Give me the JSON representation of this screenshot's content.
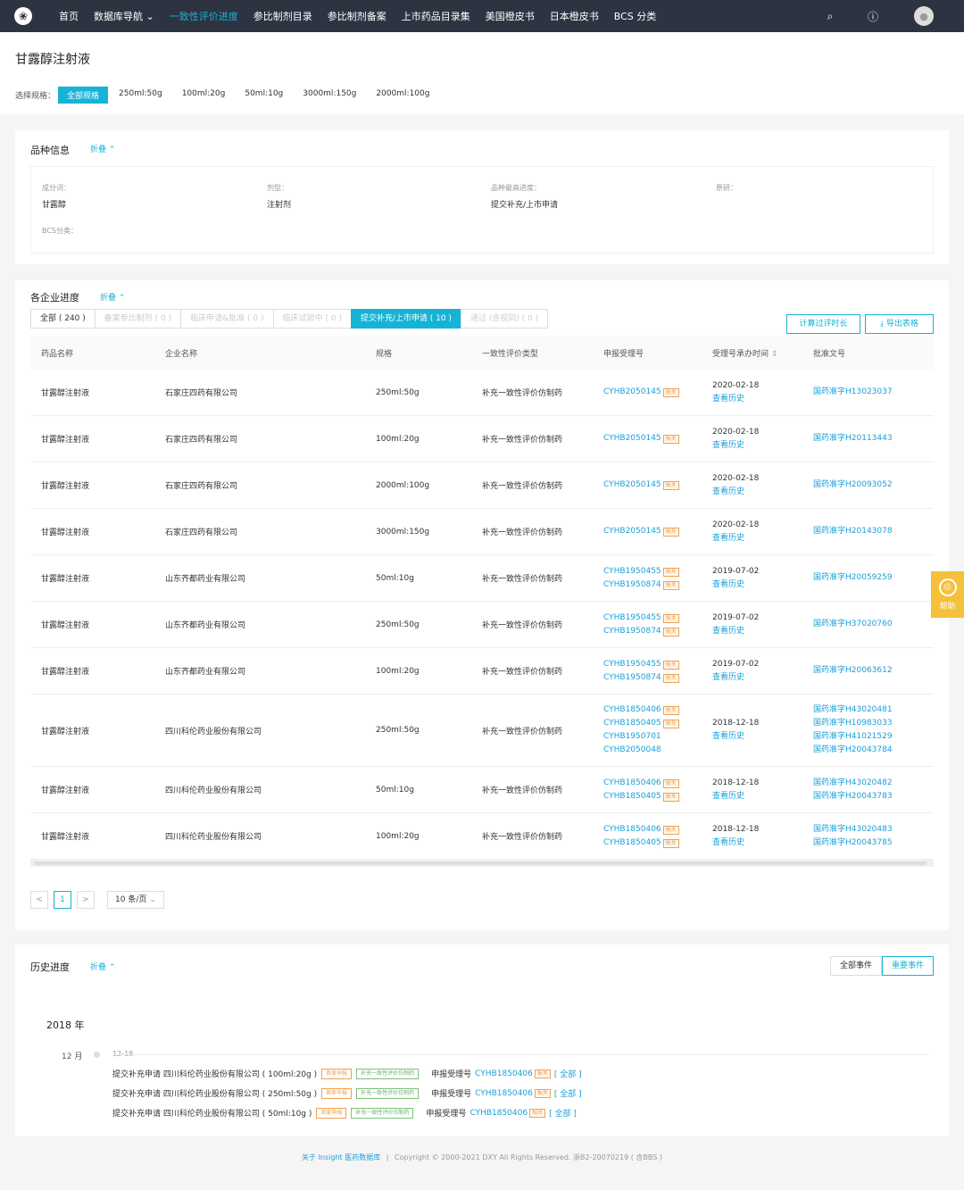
{
  "nav": {
    "items": [
      "首页",
      "数据库导航 ⌄",
      "一致性评价进度",
      "参比制剂目录",
      "参比制剂备案",
      "上市药品目录集",
      "美国橙皮书",
      "日本橙皮书",
      "BCS 分类"
    ],
    "active_index": 2
  },
  "header": {
    "title": "甘露醇注射液",
    "spec_label": "选择规格：",
    "specs": [
      "全部规格",
      "250ml:50g",
      "100ml:20g",
      "50ml:10g",
      "3000ml:150g",
      "2000ml:100g"
    ]
  },
  "variety": {
    "title": "品种信息",
    "fold": "折叠",
    "ingredient_label": "成分词：",
    "ingredient": "甘露醇",
    "form_label": "剂型：",
    "form": "注射剂",
    "progress_label": "品种最高进度：",
    "progress": "提交补充/上市申请",
    "original_label": "原研：",
    "bcs_label": "BCS分类："
  },
  "enterprise": {
    "title": "各企业进度",
    "fold": "折叠",
    "tabs": [
      "全部 ( 240 )",
      "备案参比制剂 ( 0 )",
      "临床申请&批准 ( 0 )",
      "临床试验中 ( 0 )",
      "提交补充/上市申请 ( 10 )",
      "通过 (含视同) ( 0 )"
    ],
    "calc_button": "计算过评时长",
    "export_button": "导出表格",
    "columns": [
      "药品名称",
      "企业名称",
      "规格",
      "一致性评价类型",
      "申报受理号",
      "受理号承办时间",
      "批准文号"
    ],
    "tag_text": "报关",
    "rows": [
      {
        "name": "甘露醇注射液",
        "company": "石家庄四药有限公司",
        "spec": "250ml:50g",
        "type": "补充一致性评价仿制药",
        "accept": [
          "CYHB2050145"
        ],
        "date": "2020-02-18",
        "history": "查看历史",
        "approval": [
          "国药准字H13023037"
        ]
      },
      {
        "name": "甘露醇注射液",
        "company": "石家庄四药有限公司",
        "spec": "100ml:20g",
        "type": "补充一致性评价仿制药",
        "accept": [
          "CYHB2050145"
        ],
        "date": "2020-02-18",
        "history": "查看历史",
        "approval": [
          "国药准字H20113443"
        ]
      },
      {
        "name": "甘露醇注射液",
        "company": "石家庄四药有限公司",
        "spec": "2000ml:100g",
        "type": "补充一致性评价仿制药",
        "accept": [
          "CYHB2050145"
        ],
        "date": "2020-02-18",
        "history": "查看历史",
        "approval": [
          "国药准字H20093052"
        ]
      },
      {
        "name": "甘露醇注射液",
        "company": "石家庄四药有限公司",
        "spec": "3000ml:150g",
        "type": "补充一致性评价仿制药",
        "accept": [
          "CYHB2050145"
        ],
        "date": "2020-02-18",
        "history": "查看历史",
        "approval": [
          "国药准字H20143078"
        ]
      },
      {
        "name": "甘露醇注射液",
        "company": "山东齐都药业有限公司",
        "spec": "50ml:10g",
        "type": "补充一致性评价仿制药",
        "accept": [
          "CYHB1950455",
          "CYHB1950874"
        ],
        "date": "2019-07-02",
        "history": "查看历史",
        "approval": [
          "国药准字H20059259"
        ]
      },
      {
        "name": "甘露醇注射液",
        "company": "山东齐都药业有限公司",
        "spec": "250ml:50g",
        "type": "补充一致性评价仿制药",
        "accept": [
          "CYHB1950455",
          "CYHB1950874"
        ],
        "date": "2019-07-02",
        "history": "查看历史",
        "approval": [
          "国药准字H37020760"
        ]
      },
      {
        "name": "甘露醇注射液",
        "company": "山东齐都药业有限公司",
        "spec": "100ml:20g",
        "type": "补充一致性评价仿制药",
        "accept": [
          "CYHB1950455",
          "CYHB1950874"
        ],
        "date": "2019-07-02",
        "history": "查看历史",
        "approval": [
          "国药准字H20063612"
        ]
      },
      {
        "name": "甘露醇注射液",
        "company": "四川科伦药业股份有限公司",
        "spec": "250ml:50g",
        "type": "补充一致性评价仿制药",
        "accept": [
          "CYHB1850406",
          "CYHB1850405",
          "CYHB1950701",
          "CYHB2050048"
        ],
        "date": "2018-12-18",
        "history": "查看历史",
        "approval": [
          "国药准字H43020481",
          "国药准字H10983033",
          "国药准字H41021529",
          "国药准字H20043784"
        ]
      },
      {
        "name": "甘露醇注射液",
        "company": "四川科伦药业股份有限公司",
        "spec": "50ml:10g",
        "type": "补充一致性评价仿制药",
        "accept": [
          "CYHB1850406",
          "CYHB1850405"
        ],
        "date": "2018-12-18",
        "history": "查看历史",
        "approval": [
          "国药准字H43020482",
          "国药准字H20043783"
        ]
      },
      {
        "name": "甘露醇注射液",
        "company": "四川科伦药业股份有限公司",
        "spec": "100ml:20g",
        "type": "补充一致性评价仿制药",
        "accept": [
          "CYHB1850406",
          "CYHB1850405"
        ],
        "date": "2018-12-18",
        "history": "查看历史",
        "approval": [
          "国药准字H43020483",
          "国药准字H20043785"
        ]
      }
    ],
    "pager": {
      "prev": "<",
      "page": "1",
      "next": ">",
      "size": "10 条/页"
    }
  },
  "history": {
    "title": "历史进度",
    "fold": "折叠",
    "btn_all": "全部事件",
    "btn_important": "重要事件",
    "year": "2018 年",
    "month": "12 月",
    "day": "12-18",
    "events": [
      {
        "text": "提交补充申请 四川科伦药业股份有限公司 ( 100ml:20g )",
        "tag1": "首家申报",
        "tag2": "补充一致性评价仿制药",
        "acc_label": "申报受理号",
        "acc": "CYHB1850406",
        "all": "[ 全部 ]"
      },
      {
        "text": "提交补充申请 四川科伦药业股份有限公司 ( 250ml:50g )",
        "tag1": "首家申报",
        "tag2": "补充一致性评价仿制药",
        "acc_label": "申报受理号",
        "acc": "CYHB1850406",
        "all": "[ 全部 ]"
      },
      {
        "text": "提交补充申请 四川科伦药业股份有限公司 ( 50ml:10g )",
        "tag1": "首家申报",
        "tag2": "补充一致性评价仿制药",
        "acc_label": "申报受理号",
        "acc": "CYHB1850406",
        "all": "[ 全部 ]"
      }
    ]
  },
  "help": {
    "label": "帮助"
  },
  "footer": {
    "link": "关于 Insight 医药数据库",
    "sep": "|",
    "copy": "Copyright © 2000-2021 DXY All Rights Reserved. 浙B2-20070219 ( 含BBS )"
  }
}
